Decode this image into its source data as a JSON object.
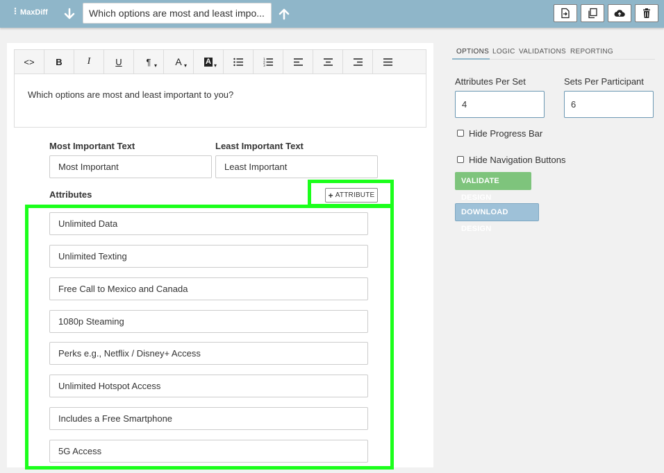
{
  "topbar": {
    "question_type": "MaxDiff",
    "question_title": "Which options are most and least impo...",
    "colors": {
      "bar": "#8fb6c9"
    },
    "actions": [
      {
        "icon": "export-icon"
      },
      {
        "icon": "duplicate-icon"
      },
      {
        "icon": "cloud-upload-icon"
      },
      {
        "icon": "trash-icon"
      }
    ]
  },
  "editor": {
    "toolbar": {
      "code": "<>",
      "bold": "B",
      "italic": "I",
      "underline": "U",
      "paragraph": "¶",
      "font_color": "A",
      "highlight": "A"
    },
    "content": "Which options are most and least important to you?"
  },
  "fields": {
    "most_label": "Most Important Text",
    "most_value": "Most Important",
    "least_label": "Least Important Text",
    "least_value": "Least Important"
  },
  "attributes": {
    "label": "Attributes",
    "add_button": "ATTRIBUTE",
    "items": [
      "Unlimited Data",
      "Unlimited Texting",
      "Free Call to Mexico and Canada",
      "1080p Steaming",
      "Perks e.g., Netflix / Disney+ Access",
      "Unlimited Hotspot Access",
      "Includes a Free Smartphone",
      "5G Access"
    ],
    "highlight_color": "#1bff1b"
  },
  "sidebar": {
    "tabs": [
      "OPTIONS",
      "LOGIC",
      "VALIDATIONS",
      "REPORTING"
    ],
    "attributes_per_set_label": "Attributes Per Set",
    "attributes_per_set_value": "4",
    "sets_per_participant_label": "Sets Per Participant",
    "sets_per_participant_value": "6",
    "hide_progress_bar": "Hide Progress Bar",
    "hide_navigation_buttons": "Hide Navigation Buttons",
    "validate_button": "VALIDATE DESIGN",
    "download_button": "DOWNLOAD DESIGN"
  }
}
